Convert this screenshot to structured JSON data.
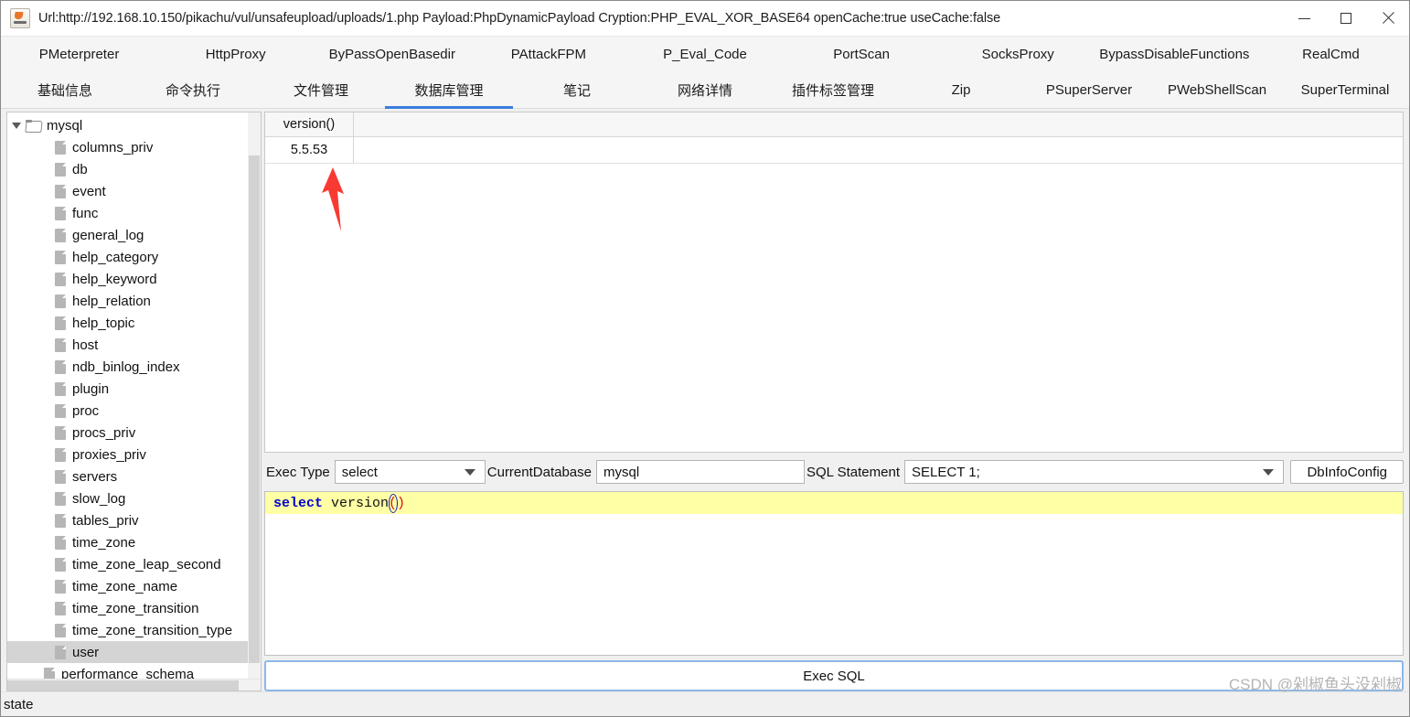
{
  "window": {
    "title": "Url:http://192.168.10.150/pikachu/vul/unsafeupload/uploads/1.php Payload:PhpDynamicPayload Cryption:PHP_EVAL_XOR_BASE64 openCache:true useCache:false",
    "icon": "java-app-icon",
    "minimize_label": "—",
    "maximize_label": "□",
    "close_label": "✕"
  },
  "plugin_tabs": [
    {
      "label": "PMeterpreter"
    },
    {
      "label": "HttpProxy"
    },
    {
      "label": "ByPassOpenBasedir"
    },
    {
      "label": "PAttackFPM"
    },
    {
      "label": "P_Eval_Code"
    },
    {
      "label": "PortScan"
    },
    {
      "label": "SocksProxy"
    },
    {
      "label": "BypassDisableFunctions"
    },
    {
      "label": "RealCmd"
    }
  ],
  "main_tabs": [
    {
      "label": "基础信息",
      "active": false
    },
    {
      "label": "命令执行",
      "active": false
    },
    {
      "label": "文件管理",
      "active": false
    },
    {
      "label": "数据库管理",
      "active": true
    },
    {
      "label": "笔记",
      "active": false
    },
    {
      "label": "网络详情",
      "active": false
    },
    {
      "label": "插件标签管理",
      "active": false
    },
    {
      "label": "Zip",
      "active": false
    },
    {
      "label": "PSuperServer",
      "active": false
    },
    {
      "label": "PWebShellScan",
      "active": false
    },
    {
      "label": "SuperTerminal",
      "active": false
    }
  ],
  "tree": {
    "nodes": [
      {
        "label": "mysql",
        "type": "database",
        "level": 0,
        "expanded": true,
        "selected": false
      },
      {
        "label": "columns_priv",
        "type": "table",
        "level": 1,
        "selected": false
      },
      {
        "label": "db",
        "type": "table",
        "level": 1,
        "selected": false
      },
      {
        "label": "event",
        "type": "table",
        "level": 1,
        "selected": false
      },
      {
        "label": "func",
        "type": "table",
        "level": 1,
        "selected": false
      },
      {
        "label": "general_log",
        "type": "table",
        "level": 1,
        "selected": false
      },
      {
        "label": "help_category",
        "type": "table",
        "level": 1,
        "selected": false
      },
      {
        "label": "help_keyword",
        "type": "table",
        "level": 1,
        "selected": false
      },
      {
        "label": "help_relation",
        "type": "table",
        "level": 1,
        "selected": false
      },
      {
        "label": "help_topic",
        "type": "table",
        "level": 1,
        "selected": false
      },
      {
        "label": "host",
        "type": "table",
        "level": 1,
        "selected": false
      },
      {
        "label": "ndb_binlog_index",
        "type": "table",
        "level": 1,
        "selected": false
      },
      {
        "label": "plugin",
        "type": "table",
        "level": 1,
        "selected": false
      },
      {
        "label": "proc",
        "type": "table",
        "level": 1,
        "selected": false
      },
      {
        "label": "procs_priv",
        "type": "table",
        "level": 1,
        "selected": false
      },
      {
        "label": "proxies_priv",
        "type": "table",
        "level": 1,
        "selected": false
      },
      {
        "label": "servers",
        "type": "table",
        "level": 1,
        "selected": false
      },
      {
        "label": "slow_log",
        "type": "table",
        "level": 1,
        "selected": false
      },
      {
        "label": "tables_priv",
        "type": "table",
        "level": 1,
        "selected": false
      },
      {
        "label": "time_zone",
        "type": "table",
        "level": 1,
        "selected": false
      },
      {
        "label": "time_zone_leap_second",
        "type": "table",
        "level": 1,
        "selected": false
      },
      {
        "label": "time_zone_name",
        "type": "table",
        "level": 1,
        "selected": false
      },
      {
        "label": "time_zone_transition",
        "type": "table",
        "level": 1,
        "selected": false
      },
      {
        "label": "time_zone_transition_type",
        "type": "table",
        "level": 1,
        "selected": false
      },
      {
        "label": "user",
        "type": "table",
        "level": 1,
        "selected": true
      },
      {
        "label": "performance_schema",
        "type": "database",
        "level": 0,
        "expanded": false,
        "selected": false
      }
    ]
  },
  "result_table": {
    "columns": [
      "version()"
    ],
    "rows": [
      [
        "5.5.53"
      ]
    ]
  },
  "controls": {
    "exec_type_label": "Exec Type",
    "exec_type_value": "select",
    "current_database_label": "CurrentDatabase",
    "current_database_value": "mysql",
    "sql_statement_label": "SQL Statement",
    "sql_statement_value": "SELECT 1;",
    "dbinfo_button": "DbInfoConfig"
  },
  "editor": {
    "keyword": "select",
    "identifier": " version",
    "open_paren": "(",
    "close_paren": ")"
  },
  "exec_button": {
    "label": "Exec SQL"
  },
  "statusbar": {
    "text": "state"
  },
  "watermark": {
    "text": "CSDN @剁椒鱼头没剁椒"
  },
  "annotation": {
    "arrow_color": "#f93a33"
  }
}
